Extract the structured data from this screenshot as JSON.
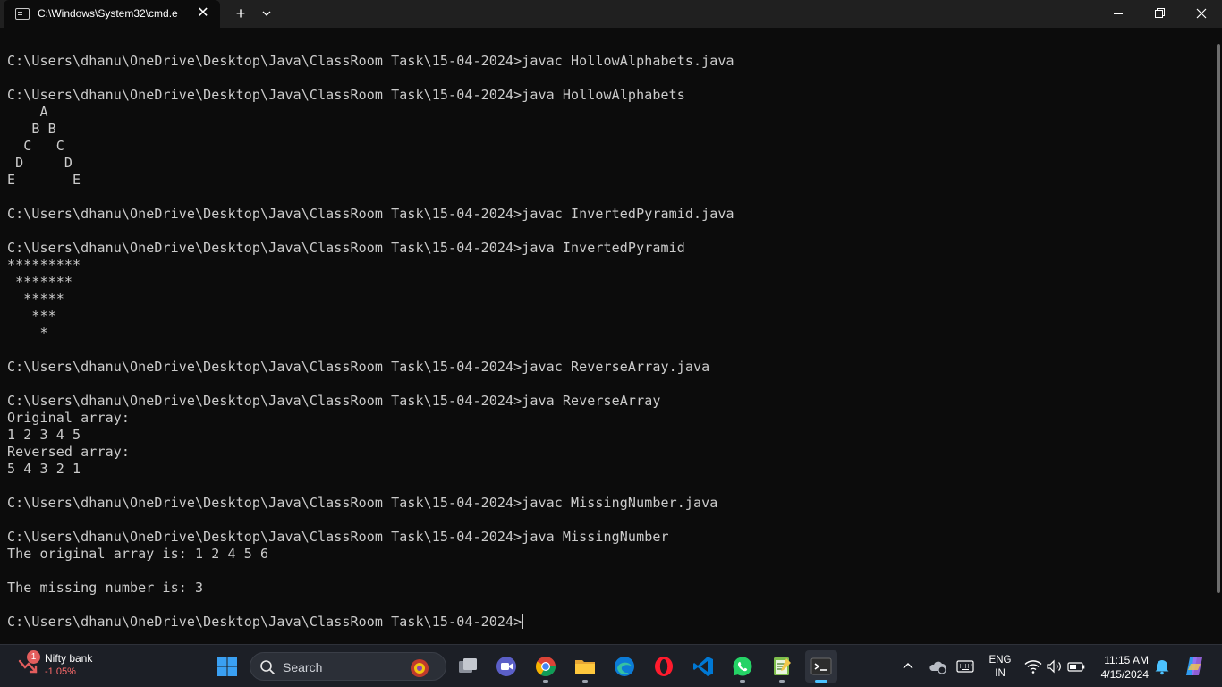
{
  "window": {
    "tab_title": "C:\\Windows\\System32\\cmd.e",
    "new_tab_glyph": "+",
    "close_glyph": "✕"
  },
  "console": {
    "lines": [
      "C:\\Users\\dhanu\\OneDrive\\Desktop\\Java\\ClassRoom Task\\15-04-2024>javac HollowAlphabets.java",
      "",
      "C:\\Users\\dhanu\\OneDrive\\Desktop\\Java\\ClassRoom Task\\15-04-2024>java HollowAlphabets",
      "    A",
      "   B B",
      "  C   C",
      " D     D",
      "E       E",
      "",
      "C:\\Users\\dhanu\\OneDrive\\Desktop\\Java\\ClassRoom Task\\15-04-2024>javac InvertedPyramid.java",
      "",
      "C:\\Users\\dhanu\\OneDrive\\Desktop\\Java\\ClassRoom Task\\15-04-2024>java InvertedPyramid",
      "*********",
      " *******",
      "  *****",
      "   ***",
      "    *",
      "",
      "C:\\Users\\dhanu\\OneDrive\\Desktop\\Java\\ClassRoom Task\\15-04-2024>javac ReverseArray.java",
      "",
      "C:\\Users\\dhanu\\OneDrive\\Desktop\\Java\\ClassRoom Task\\15-04-2024>java ReverseArray",
      "Original array:",
      "1 2 3 4 5",
      "Reversed array:",
      "5 4 3 2 1",
      "",
      "C:\\Users\\dhanu\\OneDrive\\Desktop\\Java\\ClassRoom Task\\15-04-2024>javac MissingNumber.java",
      "",
      "C:\\Users\\dhanu\\OneDrive\\Desktop\\Java\\ClassRoom Task\\15-04-2024>java MissingNumber",
      "The original array is: 1 2 4 5 6",
      "",
      "The missing number is: 3",
      "",
      "C:\\Users\\dhanu\\OneDrive\\Desktop\\Java\\ClassRoom Task\\15-04-2024>"
    ]
  },
  "taskbar": {
    "widget": {
      "badge": "1",
      "title": "Nifty bank",
      "value": "-1.05%"
    },
    "search_label": "Search",
    "apps": [
      {
        "icon": "start-icon"
      },
      {
        "icon": "search-icon"
      },
      {
        "icon": "task-view-icon"
      },
      {
        "icon": "meet-icon"
      },
      {
        "icon": "chrome-icon"
      },
      {
        "icon": "file-explorer-icon"
      },
      {
        "icon": "edge-icon"
      },
      {
        "icon": "opera-icon"
      },
      {
        "icon": "vscode-icon"
      },
      {
        "icon": "whatsapp-icon"
      },
      {
        "icon": "notepad-icon"
      },
      {
        "icon": "terminal-icon"
      }
    ],
    "language": {
      "line1": "ENG",
      "line2": "IN"
    },
    "clock": {
      "time": "11:15 AM",
      "date": "4/15/2024"
    }
  },
  "colors": {
    "console_bg": "#0c0c0c",
    "console_fg": "#cccccc",
    "titlebar_bg": "#202020",
    "taskbar_bg": "#1c1f26",
    "accent": "#4cc2ff"
  }
}
